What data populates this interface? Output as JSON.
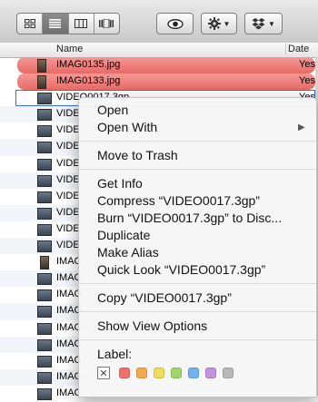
{
  "toolbar": {
    "views": [
      {
        "name": "icon-view"
      },
      {
        "name": "list-view"
      },
      {
        "name": "column-view"
      },
      {
        "name": "coverflow-view"
      }
    ],
    "active_view": 1
  },
  "list": {
    "header": {
      "name": "Name",
      "date": "Date"
    },
    "date_fragment": "Yest",
    "rows": [
      {
        "name": "IMAG0135.jpg",
        "date": "Yest",
        "style": "red",
        "icon": "vert"
      },
      {
        "name": "IMAG0133.jpg",
        "date": "Yest",
        "style": "red",
        "icon": "vert"
      },
      {
        "name": "VIDEO0017.3gp",
        "date": "Yest",
        "style": "focus",
        "icon": "video"
      },
      {
        "name": "VIDE",
        "date": "",
        "style": "",
        "icon": "video"
      },
      {
        "name": "VIDE",
        "date": "",
        "style": "",
        "icon": "video"
      },
      {
        "name": "VIDE",
        "date": "",
        "style": "",
        "icon": "video"
      },
      {
        "name": "VIDE",
        "date": "",
        "style": "",
        "icon": "video"
      },
      {
        "name": "VIDE",
        "date": "",
        "style": "",
        "icon": "video"
      },
      {
        "name": "VIDE",
        "date": "",
        "style": "",
        "icon": "video"
      },
      {
        "name": "VIDE",
        "date": "",
        "style": "",
        "icon": "video"
      },
      {
        "name": "VIDE",
        "date": "",
        "style": "",
        "icon": "video"
      },
      {
        "name": "VIDE",
        "date": "",
        "style": "",
        "icon": "video"
      },
      {
        "name": "IMAG",
        "date": "",
        "style": "",
        "icon": "vert"
      },
      {
        "name": "IMAG",
        "date": "",
        "style": "",
        "icon": "video"
      },
      {
        "name": "IMAG",
        "date": "",
        "style": "",
        "icon": "video"
      },
      {
        "name": "IMAG",
        "date": "",
        "style": "",
        "icon": "video"
      },
      {
        "name": "IMAG",
        "date": "",
        "style": "",
        "icon": "video"
      },
      {
        "name": "IMAG",
        "date": "",
        "style": "",
        "icon": "video"
      },
      {
        "name": "IMAG",
        "date": "",
        "style": "",
        "icon": "video"
      },
      {
        "name": "IMAG",
        "date": "",
        "style": "",
        "icon": "video"
      },
      {
        "name": "IMAG",
        "date": "",
        "style": "",
        "icon": "video"
      }
    ]
  },
  "menu": {
    "open": "Open",
    "open_with": "Open With",
    "move_to_trash": "Move to Trash",
    "get_info": "Get Info",
    "compress": "Compress “VIDEO0017.3gp”",
    "burn": "Burn “VIDEO0017.3gp” to Disc...",
    "duplicate": "Duplicate",
    "make_alias": "Make Alias",
    "quick_look": "Quick Look “VIDEO0017.3gp”",
    "copy": "Copy “VIDEO0017.3gp”",
    "show_view_options": "Show View Options",
    "label": "Label:",
    "label_colors": [
      "#f0716b",
      "#f4a94e",
      "#f2dd5a",
      "#9fd86a",
      "#6fb2f0",
      "#c591df",
      "#b8b8b8"
    ]
  }
}
